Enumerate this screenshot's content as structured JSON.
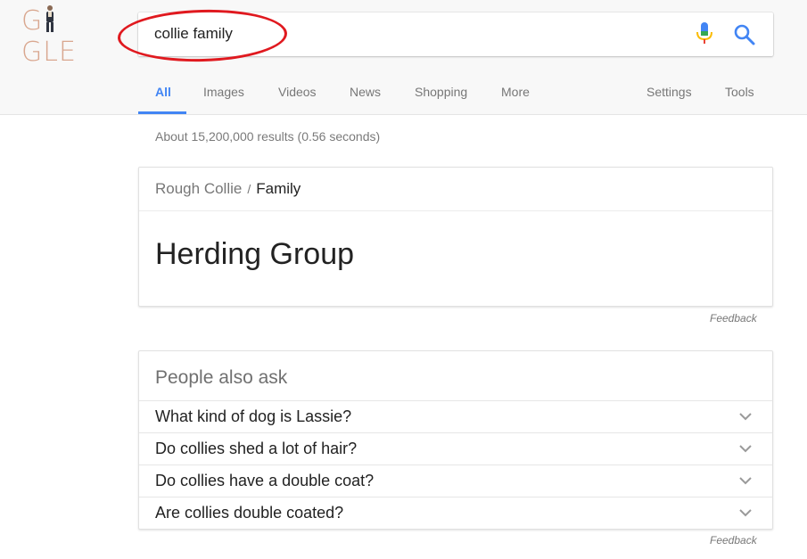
{
  "logo": {
    "text_before": "G",
    "text_after": "GLE"
  },
  "search": {
    "query": "collie family"
  },
  "nav": {
    "tabs": [
      {
        "label": "All",
        "active": true
      },
      {
        "label": "Images"
      },
      {
        "label": "Videos"
      },
      {
        "label": "News"
      },
      {
        "label": "Shopping"
      },
      {
        "label": "More"
      }
    ],
    "settings": "Settings",
    "tools": "Tools"
  },
  "results": {
    "count_text": "About 15,200,000 results (0.56 seconds)"
  },
  "knowledge_panel": {
    "breadcrumb_link": "Rough Collie",
    "breadcrumb_sep": "/",
    "breadcrumb_current": "Family",
    "answer": "Herding Group",
    "feedback": "Feedback"
  },
  "people_also_ask": {
    "title": "People also ask",
    "questions": [
      "What kind of dog is Lassie?",
      "Do collies shed a lot of hair?",
      "Do collies have a double coat?",
      "Are collies double coated?"
    ],
    "feedback": "Feedback"
  },
  "colors": {
    "accent": "#4285f4",
    "annotation": "#e0191f",
    "logo": "#d9a78f"
  },
  "icons": {
    "mic": "microphone-icon",
    "search": "search-icon",
    "expand": "chevron-down-icon"
  }
}
